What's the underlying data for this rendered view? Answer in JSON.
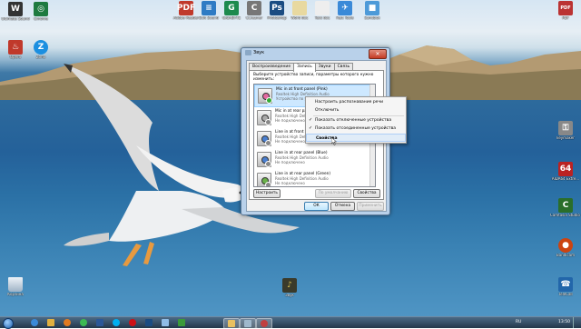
{
  "desktop_icons_top": [
    {
      "label": "Adobe Reader",
      "icon": "pdf-icon",
      "color": "#c0392b",
      "glyph": "PDF"
    },
    {
      "label": "Edit Sound",
      "icon": "document-icon",
      "color": "#2e7bc4",
      "glyph": "≡"
    },
    {
      "label": "GIGABYTE",
      "icon": "app-icon",
      "color": "#1d8a4e",
      "glyph": "G"
    },
    {
      "label": "CCleaner",
      "icon": "broom-icon",
      "color": "#777",
      "glyph": "C"
    },
    {
      "label": "Photoshop",
      "icon": "photoshop-icon",
      "color": "#1a4c82",
      "glyph": "Ps"
    },
    {
      "label": "Word doc",
      "icon": "file-icon",
      "color": "#e8d9a0",
      "glyph": ""
    },
    {
      "label": "Text doc",
      "icon": "file-icon",
      "color": "#eee",
      "glyph": ""
    },
    {
      "label": "Fast Tools",
      "icon": "plane-icon",
      "color": "#3a8ad8",
      "glyph": "✈"
    },
    {
      "label": "Sandbox",
      "icon": "box-icon",
      "color": "#4d9ad8",
      "glyph": "■"
    }
  ],
  "desktop_icons_left": [
    {
      "label": "Ultimate Sound",
      "icon": "tool-icon",
      "color": "#333",
      "glyph": "W"
    },
    {
      "label": "Chrome",
      "icon": "chrome-icon",
      "color": "#1e7a3f",
      "glyph": "◎"
    },
    {
      "label": "Opera",
      "icon": "flame-icon",
      "color": "#c0392b",
      "glyph": "♨"
    },
    {
      "label": "Zona",
      "icon": "zona-icon",
      "color": "#1b8fe0",
      "glyph": "Z"
    }
  ],
  "desktop_icons_right": [
    {
      "label": "PDF",
      "icon": "pdf-icon",
      "color": "#b33",
      "glyph": "PDF"
    },
    {
      "label": "keymaker",
      "icon": "key-icon",
      "color": "#888",
      "glyph": "⚿"
    },
    {
      "label": "AIDA64 Extre...",
      "icon": "aida-icon",
      "color": "#b22",
      "glyph": "64"
    },
    {
      "label": "Camtasia Studio 8",
      "icon": "camtasia-icon",
      "color": "#2a6e2a",
      "glyph": "C"
    },
    {
      "label": "Bandicam",
      "icon": "record-icon",
      "color": "#c41",
      "glyph": "●"
    },
    {
      "label": "TeleCall",
      "icon": "phone-icon",
      "color": "#26a",
      "glyph": "☎"
    }
  ],
  "recycle_bin": {
    "label": "Корзина",
    "icon": "recycle-bin-icon"
  },
  "zvuk_shortcut": {
    "label": "Звук",
    "icon": "speaker-icon"
  },
  "dialog": {
    "title": "Звук",
    "tabs": [
      "Воспроизведение",
      "Запись",
      "Звуки",
      "Связь"
    ],
    "active_tab": 1,
    "instruction": "Выберите устройство записи, параметры которого нужно изменить:",
    "devices": [
      {
        "name": "Mic in at front panel (Pink)",
        "driver": "Realtek High Definition Audio",
        "status": "Устройство по умолчанию",
        "jack": "pink",
        "selected": true,
        "enabled": true
      },
      {
        "name": "Mic in at rear panel (Pink)",
        "driver": "Realtek High Definition Audio",
        "status": "Не подключено",
        "jack": "gray",
        "selected": false,
        "enabled": false
      },
      {
        "name": "Line in at front panel (Blue)",
        "driver": "Realtek High Definition Audio",
        "status": "Не подключено",
        "jack": "blue",
        "selected": false,
        "enabled": false
      },
      {
        "name": "Line in at rear panel (Blue)",
        "driver": "Realtek High Definition Audio",
        "status": "Не подключено",
        "jack": "blue",
        "selected": false,
        "enabled": false
      },
      {
        "name": "Line in at rear panel (Green)",
        "driver": "Realtek High Definition Audio",
        "status": "Не подключено",
        "jack": "green",
        "selected": false,
        "enabled": false
      }
    ],
    "configure_button": "Настроить",
    "default_button": "По умолчанию",
    "properties_button": "Свойства",
    "ok_button": "ОК",
    "cancel_button": "Отмена",
    "apply_button": "Применить"
  },
  "context_menu": {
    "items": [
      {
        "label": "Настроить распознавание речи",
        "checked": false
      },
      {
        "label": "Отключить",
        "checked": false
      },
      {
        "label": "Показать отключенные устройства",
        "checked": true
      },
      {
        "label": "Показать отсоединенные устройства",
        "checked": true
      },
      {
        "label": "Свойства",
        "checked": false,
        "bold": true,
        "highlighted": true
      }
    ]
  },
  "taskbar": {
    "pinned": [
      {
        "icon": "ie-icon",
        "color": "#3a8ad8"
      },
      {
        "icon": "explorer-icon",
        "color": "#e0b040"
      },
      {
        "icon": "media-player-icon",
        "color": "#e07a20"
      },
      {
        "icon": "chrome-icon",
        "color": "#3cba54"
      },
      {
        "icon": "word-icon",
        "color": "#2b5797"
      },
      {
        "icon": "skype-icon",
        "color": "#00aff0"
      },
      {
        "icon": "opera-icon",
        "color": "#cc0f16"
      },
      {
        "icon": "photoshop-icon",
        "color": "#1a4c82"
      },
      {
        "icon": "notepad-icon",
        "color": "#8fbce6"
      },
      {
        "icon": "camtasia-icon",
        "color": "#3a9a3a"
      },
      {
        "icon": "folder-icon",
        "color": "#e8c060"
      },
      {
        "icon": "sound-icon",
        "color": "#9fb8cc"
      },
      {
        "icon": "recorder-icon",
        "color": "#c04040"
      }
    ],
    "language": "RU",
    "clock": "13:50"
  }
}
